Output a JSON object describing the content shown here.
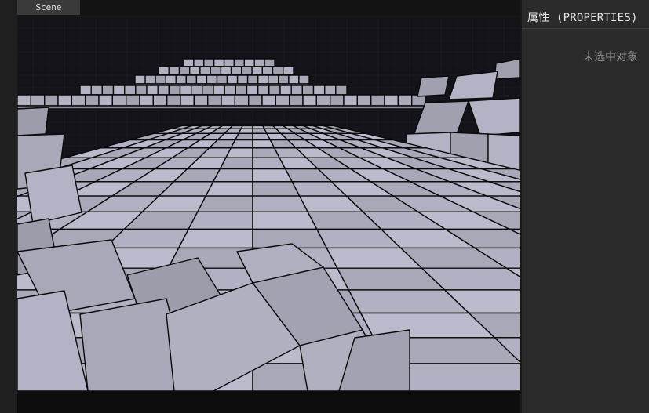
{
  "scene_panel": {
    "tab_label": "Scene",
    "fill_color": "#c3c3d6",
    "line_color": "#0a0a0a",
    "sky_color": "#131319"
  },
  "properties_panel": {
    "title": "属性 (PROPERTIES)",
    "empty_message": "未选中对象"
  }
}
